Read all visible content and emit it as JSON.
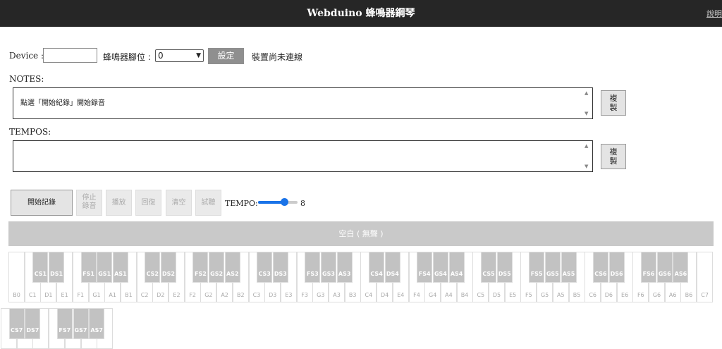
{
  "header": {
    "title": "Webduino 蜂鳴器鋼琴",
    "link": "說明"
  },
  "device": {
    "label": "Device :",
    "value": ""
  },
  "pin": {
    "label": "蜂鳴器腳位 :",
    "selected": "0"
  },
  "set_button": "設定",
  "connection_status": "裝置尚未連線",
  "notes": {
    "label": "NOTES:",
    "value": "點選「開始紀錄」開始錄音",
    "copy": "複\n製"
  },
  "tempos": {
    "label": "TEMPOS:",
    "value": "",
    "copy": "複\n製"
  },
  "controls": {
    "record": "開始記錄",
    "stop": "停止\n錄音",
    "play": "播放",
    "reply": "回復",
    "clear": "清空",
    "listen": "試聽"
  },
  "tempo": {
    "label": "TEMPO:",
    "value": "8",
    "level_fraction": 0.72
  },
  "status_bar": "空白 ( 無聲 )",
  "keyboard": {
    "row1_white": [
      "B0",
      "C1",
      "D1",
      "E1",
      "F1",
      "G1",
      "A1",
      "B1",
      "C2",
      "D2",
      "E2",
      "F2",
      "G2",
      "A2",
      "B2",
      "C3",
      "D3",
      "E3",
      "F3",
      "G3",
      "A3",
      "B3",
      "C4",
      "D4",
      "E4",
      "F4",
      "G4",
      "A4",
      "B4",
      "C5",
      "D5",
      "E5",
      "F5",
      "G5",
      "A5",
      "B5",
      "C6",
      "D6",
      "E6",
      "F6",
      "G6",
      "A6",
      "B6",
      "C7"
    ],
    "row1_black": [
      "CS1",
      "DS1",
      "FS1",
      "GS1",
      "AS1",
      "CS2",
      "DS2",
      "FS2",
      "GS2",
      "AS2",
      "CS3",
      "DS3",
      "FS3",
      "GS3",
      "AS3",
      "CS4",
      "DS4",
      "FS4",
      "GS4",
      "AS4",
      "CS5",
      "DS5",
      "FS5",
      "GS5",
      "AS5",
      "CS6",
      "DS6",
      "FS6",
      "GS6",
      "AS6"
    ],
    "row2_black": [
      "CS7",
      "DS7",
      "FS7",
      "GS7",
      "AS7"
    ]
  }
}
